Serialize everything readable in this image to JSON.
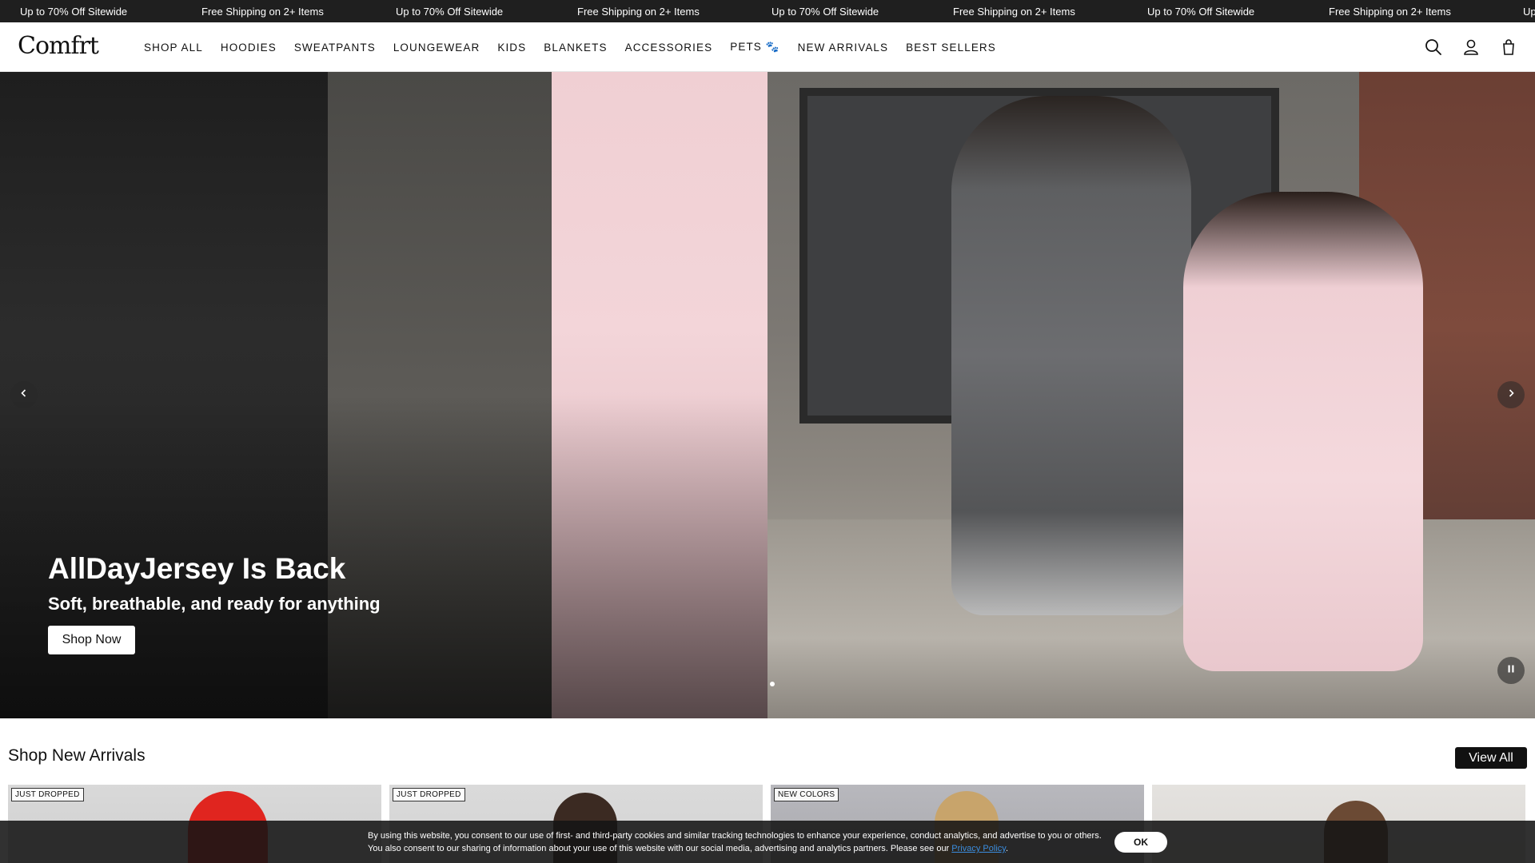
{
  "announcement": {
    "items": [
      "Up to 70% Off Sitewide",
      "Free Shipping on 2+ Items",
      "Up to 70% Off Sitewide",
      "Free Shipping on 2+ Items",
      "Up to 70% Off Sitewide",
      "Free Shipping on 2+ Items",
      "Up to 70% Off Sitewide",
      "Free Shipping on 2+ Items",
      "Up"
    ]
  },
  "header": {
    "logo": "Comfrt",
    "nav": [
      "SHOP ALL",
      "HOODIES",
      "SWEATPANTS",
      "LOUNGEWEAR",
      "KIDS",
      "BLANKETS",
      "ACCESSORIES",
      "PETS 🐾",
      "NEW ARRIVALS",
      "BEST SELLERS"
    ],
    "icons": [
      "search-icon",
      "account-icon",
      "cart-icon"
    ]
  },
  "hero": {
    "title": "AllDayJersey Is Back",
    "subtitle": "Soft, breathable, and ready for anything",
    "cta": "Shop Now",
    "prev_icon": "‹",
    "next_icon": "›",
    "pause_icon": "❚❚"
  },
  "new_arrivals": {
    "title": "Shop New Arrivals",
    "view_all": "View All",
    "cards": [
      {
        "badge": "JUST DROPPED"
      },
      {
        "badge": "JUST DROPPED"
      },
      {
        "badge": "NEW COLORS"
      },
      {
        "badge": ""
      }
    ]
  },
  "cookie": {
    "line1": "By using this website, you consent to our use of first- and third-party cookies and similar tracking technologies to enhance your experience, conduct analytics, and advertise to you or others.",
    "line2": "You also consent to our sharing of information about your use of this website with our social media, advertising and analytics partners. Please see our",
    "link": "Privacy Policy",
    "period": ".",
    "ok": "OK"
  },
  "colors": {
    "announce_bg": "#1f1f1f",
    "accent": "#111111",
    "link": "#3b8dde"
  }
}
